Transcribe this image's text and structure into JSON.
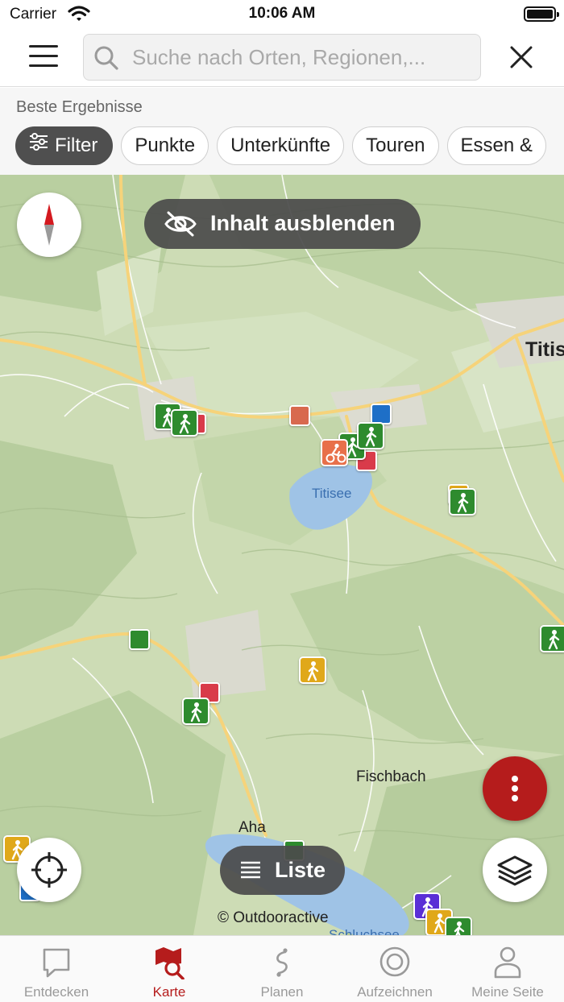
{
  "status_bar": {
    "carrier": "Carrier",
    "time": "10:06 AM"
  },
  "search": {
    "placeholder": "Suche nach Orten, Regionen,..."
  },
  "results": {
    "heading": "Beste Ergebnisse",
    "chips": [
      "Filter",
      "Punkte",
      "Unterkünfte",
      "Touren",
      "Essen &"
    ]
  },
  "map": {
    "hide_content_label": "Inhalt ausblenden",
    "list_label": "Liste",
    "attribution": "© Outdooractive",
    "places": [
      "Titis",
      "Titisee",
      "Fischbach",
      "Aha",
      "Schluchsee"
    ]
  },
  "colors": {
    "accent": "#b51c1c",
    "hiking": "#2e8b2e",
    "accommodation": "#d93b4a",
    "blue_poi": "#1e6fc7",
    "yellow_poi": "#e0a81a",
    "orange_poi": "#e8704a",
    "water": "#9fc3e6"
  },
  "tabbar": {
    "tabs": [
      {
        "label": "Entdecken",
        "icon": "speech-bubble-icon"
      },
      {
        "label": "Karte",
        "icon": "map-search-icon"
      },
      {
        "label": "Planen",
        "icon": "route-icon"
      },
      {
        "label": "Aufzeichnen",
        "icon": "record-icon"
      },
      {
        "label": "Meine Seite",
        "icon": "person-icon"
      }
    ],
    "active": "Karte"
  }
}
